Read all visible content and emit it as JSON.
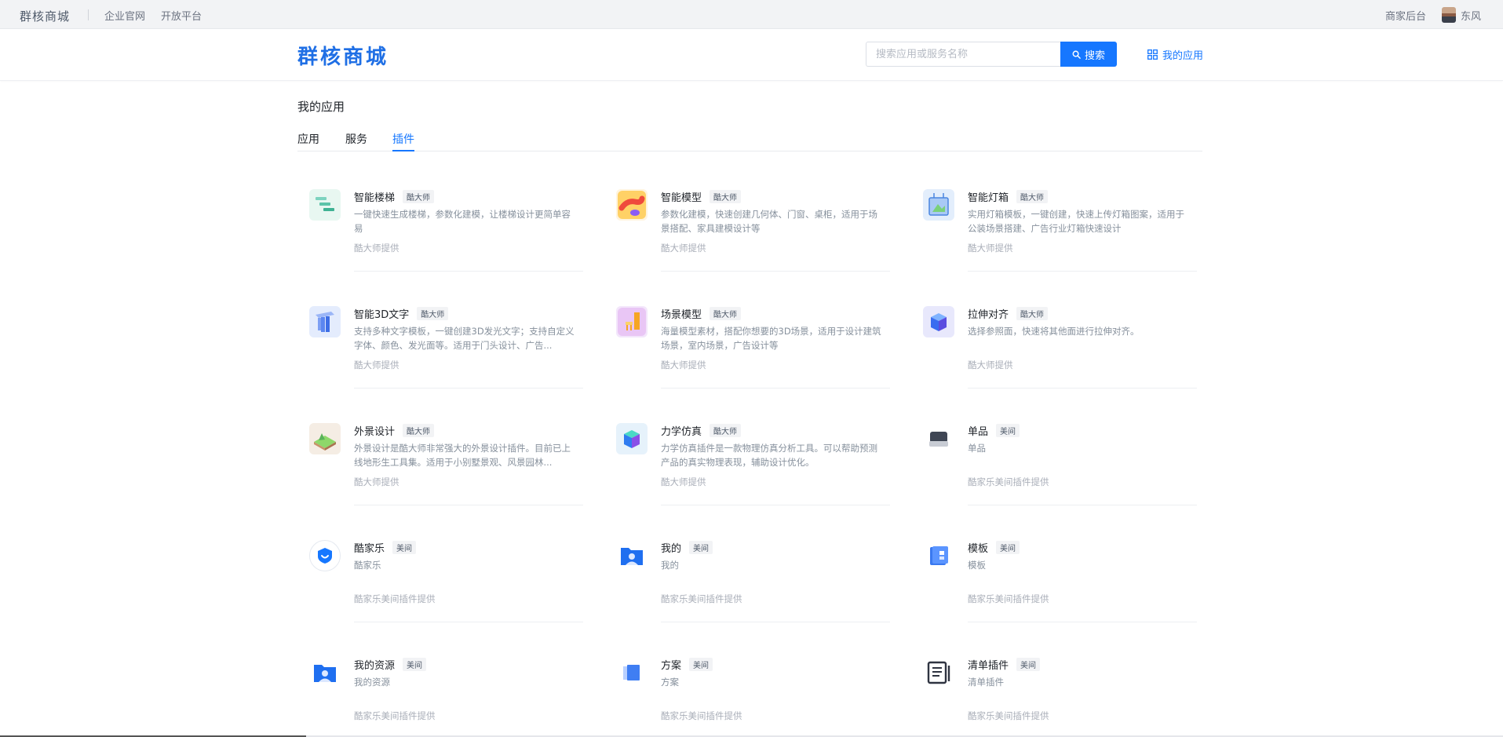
{
  "topbar": {
    "brand": "群核商城",
    "links": [
      "企业官网",
      "开放平台"
    ],
    "merchant": "商家后台",
    "user_name": "东风"
  },
  "header": {
    "logo": "群核商城",
    "search_placeholder": "搜索应用或服务名称",
    "search_button": "搜索",
    "my_apps": "我的应用"
  },
  "page": {
    "title": "我的应用",
    "tabs": [
      {
        "label": "应用",
        "active": false
      },
      {
        "label": "服务",
        "active": false
      },
      {
        "label": "插件",
        "active": true
      }
    ]
  },
  "plugins": [
    {
      "name": "智能楼梯",
      "tag": "酷大师",
      "desc": "一键快速生成楼梯，参数化建模，让楼梯设计更简单容易",
      "provider": "酷大师提供",
      "icon": "stairs-icon"
    },
    {
      "name": "智能模型",
      "tag": "酷大师",
      "desc": "参数化建模，快速创建几何体、门窗、桌柜，适用于场景搭配、家具建模设计等",
      "provider": "酷大师提供",
      "icon": "model-icon"
    },
    {
      "name": "智能灯箱",
      "tag": "酷大师",
      "desc": "实用灯箱模板，一键创建，快速上传灯箱图案，适用于公装场景搭建、广告行业灯箱快速设计",
      "provider": "酷大师提供",
      "icon": "lightbox-icon"
    },
    {
      "name": "智能3D文字",
      "tag": "酷大师",
      "desc": "支持多种文字模板，一键创建3D发光文字；支持自定义字体、颜色、发光面等。适用于门头设计、广告...",
      "provider": "酷大师提供",
      "icon": "3d-text-icon"
    },
    {
      "name": "场景模型",
      "tag": "酷大师",
      "desc": "海量模型素材，搭配你想要的3D场景，适用于设计建筑场景，室内场景，广告设计等",
      "provider": "酷大师提供",
      "icon": "scene-model-icon"
    },
    {
      "name": "拉伸对齐",
      "tag": "酷大师",
      "desc": "选择参照面，快速将其他面进行拉伸对齐。",
      "provider": "酷大师提供",
      "icon": "stretch-align-icon"
    },
    {
      "name": "外景设计",
      "tag": "酷大师",
      "desc": "外景设计是酷大师非常强大的外景设计插件。目前已上线地形生工具集。适用于小别墅景观、风景园林...",
      "provider": "酷大师提供",
      "icon": "landscape-icon"
    },
    {
      "name": "力学仿真",
      "tag": "酷大师",
      "desc": "力学仿真插件是一款物理仿真分析工具。可以帮助预测产品的真实物理表现，辅助设计优化。",
      "provider": "酷大师提供",
      "icon": "physics-cube-icon"
    },
    {
      "name": "单品",
      "tag": "美间",
      "desc": "单品",
      "provider": "酷家乐美间插件提供",
      "icon": "item-icon"
    },
    {
      "name": "酷家乐",
      "tag": "美间",
      "desc": "酷家乐",
      "provider": "酷家乐美间插件提供",
      "icon": "shield-icon"
    },
    {
      "name": "我的",
      "tag": "美间",
      "desc": "我的",
      "provider": "酷家乐美间插件提供",
      "icon": "user-folder-icon"
    },
    {
      "name": "模板",
      "tag": "美间",
      "desc": "模板",
      "provider": "酷家乐美间插件提供",
      "icon": "template-icon"
    },
    {
      "name": "我的资源",
      "tag": "美间",
      "desc": "我的资源",
      "provider": "酷家乐美间插件提供",
      "icon": "resource-folder-icon"
    },
    {
      "name": "方案",
      "tag": "美间",
      "desc": "方案",
      "provider": "酷家乐美间插件提供",
      "icon": "plan-icon"
    },
    {
      "name": "清单插件",
      "tag": "美间",
      "desc": "清单插件",
      "provider": "酷家乐美间插件提供",
      "icon": "list-icon"
    }
  ],
  "colors": {
    "accent": "#1677ff",
    "logo": "#1f6fe5"
  }
}
